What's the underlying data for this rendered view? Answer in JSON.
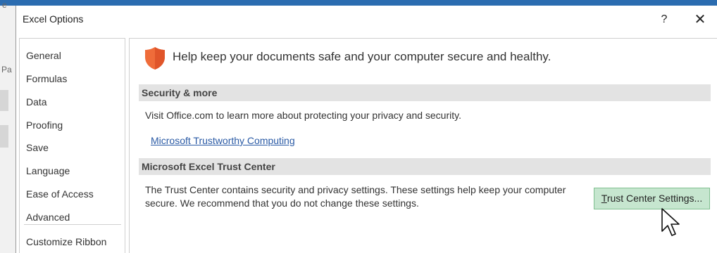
{
  "background": {
    "left_fragments": [
      "e",
      "Pa"
    ]
  },
  "dialog": {
    "title": "Excel Options",
    "help_label": "?",
    "close_label": "✕"
  },
  "nav": {
    "items": [
      {
        "label": "General"
      },
      {
        "label": "Formulas"
      },
      {
        "label": "Data"
      },
      {
        "label": "Proofing"
      },
      {
        "label": "Save"
      },
      {
        "label": "Language"
      },
      {
        "label": "Ease of Access"
      },
      {
        "label": "Advanced"
      },
      {
        "label": "Customize Ribbon"
      }
    ]
  },
  "main": {
    "header": "Help keep your documents safe and your computer secure and healthy.",
    "security_section": {
      "title": "Security & more",
      "text": "Visit Office.com to learn more about protecting your privacy and security.",
      "link": "Microsoft Trustworthy Computing"
    },
    "trust_section": {
      "title": "Microsoft Excel Trust Center",
      "text_line1": "The Trust Center contains security and privacy settings. These settings help keep your computer",
      "text_line2": "secure. We recommend that you do not change these settings.",
      "button_first_letter": "T",
      "button_rest": "rust Center Settings..."
    }
  },
  "colors": {
    "shield": "#ef6c3a",
    "button_bg": "#c6e6cf",
    "link": "#2a5aa5",
    "section_bg": "#e3e3e3"
  }
}
